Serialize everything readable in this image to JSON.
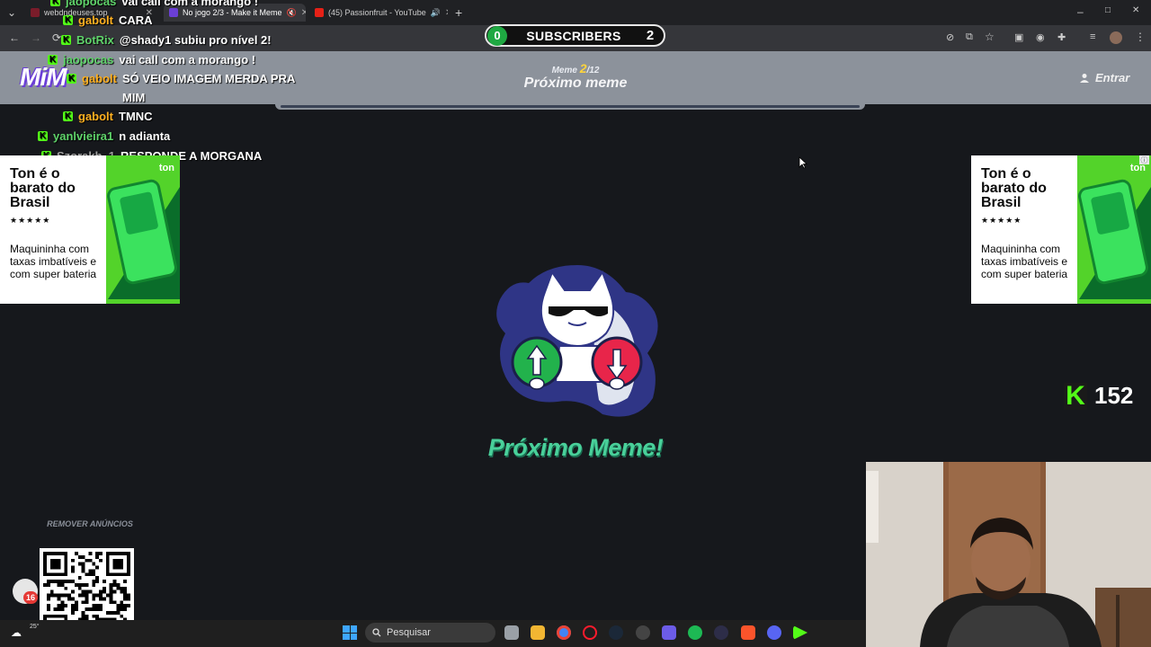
{
  "browser": {
    "tabs": [
      {
        "label": "webdndeuses.top",
        "active": false
      },
      {
        "label": "No jogo 2/3 - Make it Meme",
        "active": true
      },
      {
        "label": "(45) Passionfruit - YouTube",
        "active": false
      }
    ],
    "new_tab": "+",
    "window_controls": [
      "–",
      "□",
      "✕"
    ]
  },
  "overlay": {
    "subscribers": {
      "left_count": "0",
      "label": "SUBSCRIBERS",
      "right_count": "2"
    },
    "chat": [
      {
        "user": "jaopocas",
        "message": "vai call com a morango !",
        "user_color": "#5fd36a"
      },
      {
        "user": "gabolt",
        "message": "CARA",
        "user_color": "#ffb020"
      },
      {
        "user": "BotRix",
        "message": "@shady1 subiu pro nível 2!",
        "user_color": "#5fd36a"
      },
      {
        "user": "jaopocas",
        "message": "vai call com a morango !",
        "user_color": "#5fd36a"
      },
      {
        "user": "gabolt",
        "message": "SÓ VEIO IMAGEM MERDA PRA",
        "user_color": "#ffb020"
      },
      {
        "user": "",
        "message": "MIM",
        "user_color": "#ffb020"
      },
      {
        "user": "gabolt",
        "message": "TMNC",
        "user_color": "#ffb020"
      },
      {
        "user": "yanlvieira1",
        "message": "n adianta",
        "user_color": "#5fd36a"
      },
      {
        "user": "Szorakh_1",
        "message": "RESPONDE A MORGANA",
        "user_color": "#a0a0a0"
      }
    ],
    "kick_viewers": "152"
  },
  "site": {
    "logo": "MiM",
    "meme_prefix": "Meme",
    "meme_current": "2",
    "meme_total": "/12",
    "header_title": "Próximo meme",
    "login_label": "Entrar",
    "cta": "Próximo Meme!",
    "remove_ads": "REMOVER ANÚNCIOS"
  },
  "ads": {
    "title": "Ton é o barato do Brasil",
    "stars": "★★★★★",
    "subtitle": "Maquininha com taxas imbatíveis e com super bateria",
    "logo": "ton"
  },
  "taskbar": {
    "search_placeholder": "Pesquisar",
    "weather": "25°",
    "notification_badge": "16"
  },
  "colors": {
    "accent_green": "#49d09a",
    "kick_green": "#53fc18",
    "header_bg": "#8c929b",
    "page_bg": "#16181c"
  }
}
